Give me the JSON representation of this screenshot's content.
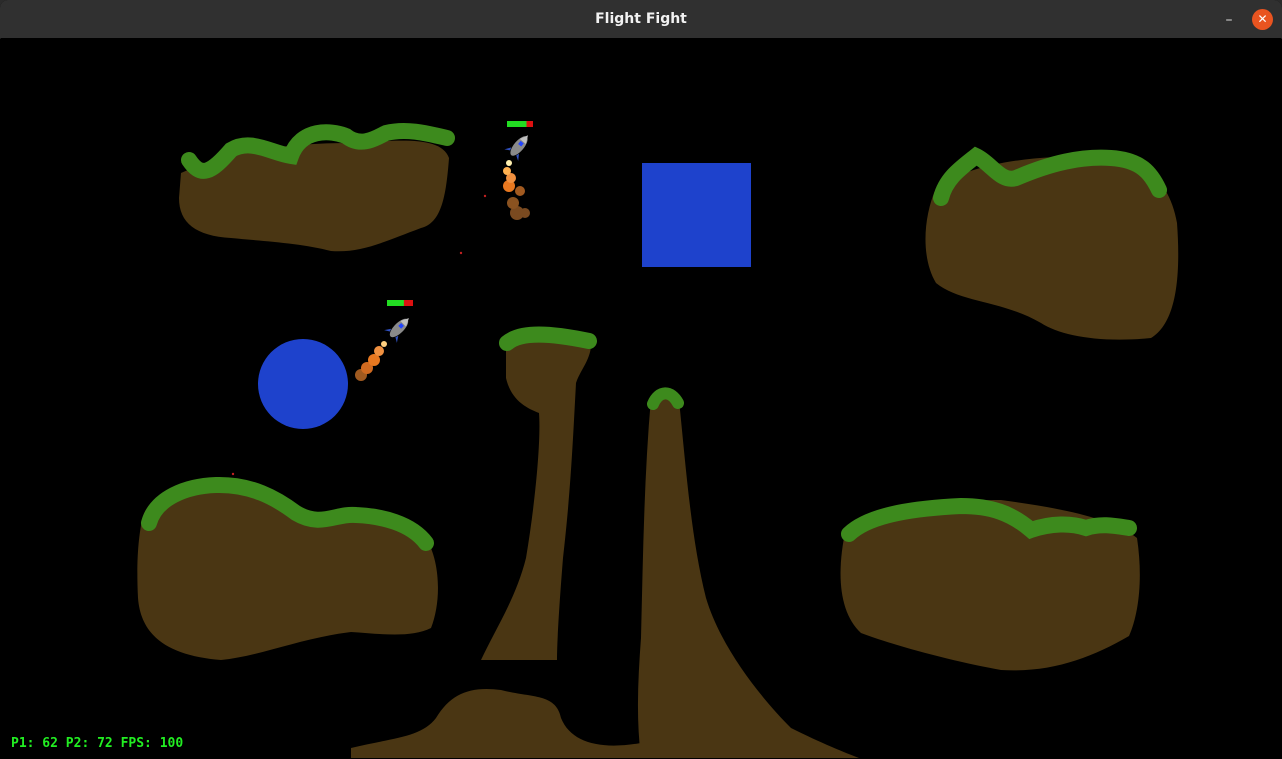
{
  "window": {
    "title": "Flight Fight"
  },
  "titlebar": {
    "minimize_icon": "minimize-icon",
    "close_icon": "close-icon"
  },
  "hud": {
    "text": "P1: 62 P2: 72 FPS: 100"
  },
  "colors": {
    "background": "#000000",
    "terrain": "#4a3613",
    "grass": "#3d8a1d",
    "obstacle": "#1e42cc",
    "health_good": "#22dd22",
    "health_bad": "#dd1111",
    "hud_text": "#22ee22",
    "close_button": "#e95420"
  },
  "players": [
    {
      "id": "p1",
      "health_fraction": 0.75,
      "icon": "rocket-icon"
    },
    {
      "id": "p2",
      "health_fraction": 0.65,
      "icon": "rocket-icon"
    }
  ]
}
